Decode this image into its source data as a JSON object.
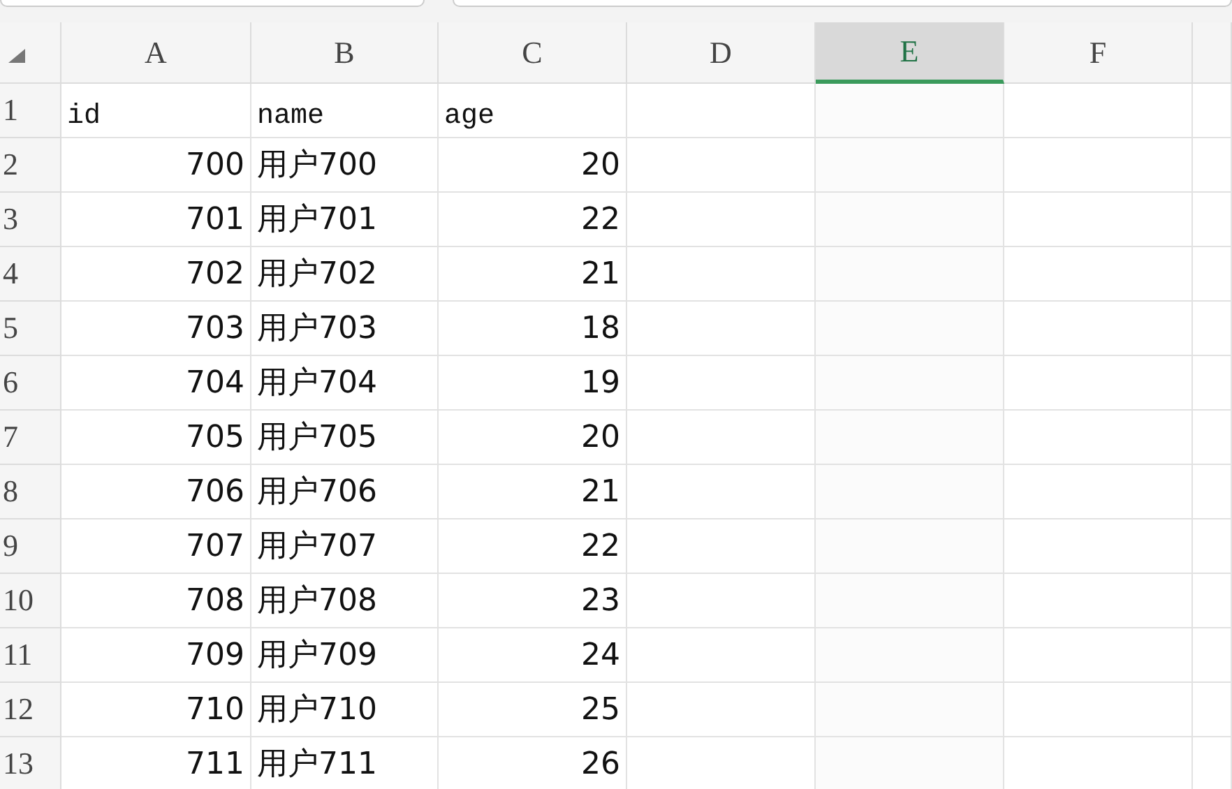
{
  "columns": [
    {
      "label": "A",
      "kind": "number",
      "selected": false
    },
    {
      "label": "B",
      "kind": "text",
      "selected": false
    },
    {
      "label": "C",
      "kind": "number",
      "selected": false
    },
    {
      "label": "D",
      "kind": "text",
      "selected": false
    },
    {
      "label": "E",
      "kind": "text",
      "selected": true
    },
    {
      "label": "F",
      "kind": "text",
      "selected": false
    }
  ],
  "rows": [
    {
      "label": "1",
      "kind": "header",
      "cells": [
        "id",
        "name",
        "age"
      ]
    },
    {
      "label": "2",
      "kind": "data",
      "cells": [
        "700",
        "用户700",
        "20"
      ]
    },
    {
      "label": "3",
      "kind": "data",
      "cells": [
        "701",
        "用户701",
        "22"
      ]
    },
    {
      "label": "4",
      "kind": "data",
      "cells": [
        "702",
        "用户702",
        "21"
      ]
    },
    {
      "label": "5",
      "kind": "data",
      "cells": [
        "703",
        "用户703",
        "18"
      ]
    },
    {
      "label": "6",
      "kind": "data",
      "cells": [
        "704",
        "用户704",
        "19"
      ]
    },
    {
      "label": "7",
      "kind": "data",
      "cells": [
        "705",
        "用户705",
        "20"
      ]
    },
    {
      "label": "8",
      "kind": "data",
      "cells": [
        "706",
        "用户706",
        "21"
      ]
    },
    {
      "label": "9",
      "kind": "data",
      "cells": [
        "707",
        "用户707",
        "22"
      ]
    },
    {
      "label": "10",
      "kind": "data",
      "cells": [
        "708",
        "用户708",
        "23"
      ]
    },
    {
      "label": "11",
      "kind": "data",
      "cells": [
        "709",
        "用户709",
        "24"
      ]
    },
    {
      "label": "12",
      "kind": "data",
      "cells": [
        "710",
        "用户710",
        "25"
      ]
    },
    {
      "label": "13",
      "kind": "data",
      "cells": [
        "711",
        "用户711",
        "26"
      ]
    }
  ]
}
